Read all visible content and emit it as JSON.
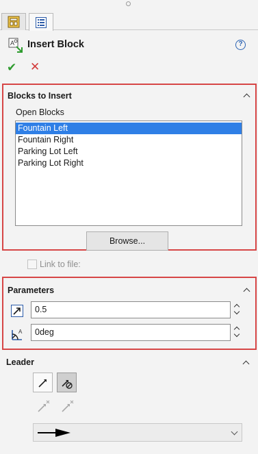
{
  "header": {
    "title": "Insert Block",
    "help_label": "?"
  },
  "tabs": [
    {
      "name": "property-manager",
      "active": false
    },
    {
      "name": "feature-manager",
      "active": true
    }
  ],
  "actions": {
    "ok_label": "✔",
    "cancel_label": "✕"
  },
  "blocks_to_insert": {
    "title": "Blocks to Insert",
    "open_blocks_label": "Open Blocks",
    "items": [
      "Fountain Left",
      "Fountain Right",
      "Parking Lot Left",
      "Parking Lot Right"
    ],
    "selected": "Fountain Left",
    "browse_label": "Browse..."
  },
  "link_to_file": {
    "label": "Link to file:",
    "checked": false,
    "enabled": false
  },
  "parameters": {
    "title": "Parameters",
    "scale_value": "0.5",
    "angle_value": "0deg"
  },
  "leader": {
    "title": "Leader",
    "arrow_style": "solid-filled-arrow"
  },
  "colors": {
    "accent_blue": "#2f7fe6",
    "highlight_red": "#d64545",
    "ok_green": "#2e9b2e",
    "cancel_red": "#d23a3a"
  }
}
